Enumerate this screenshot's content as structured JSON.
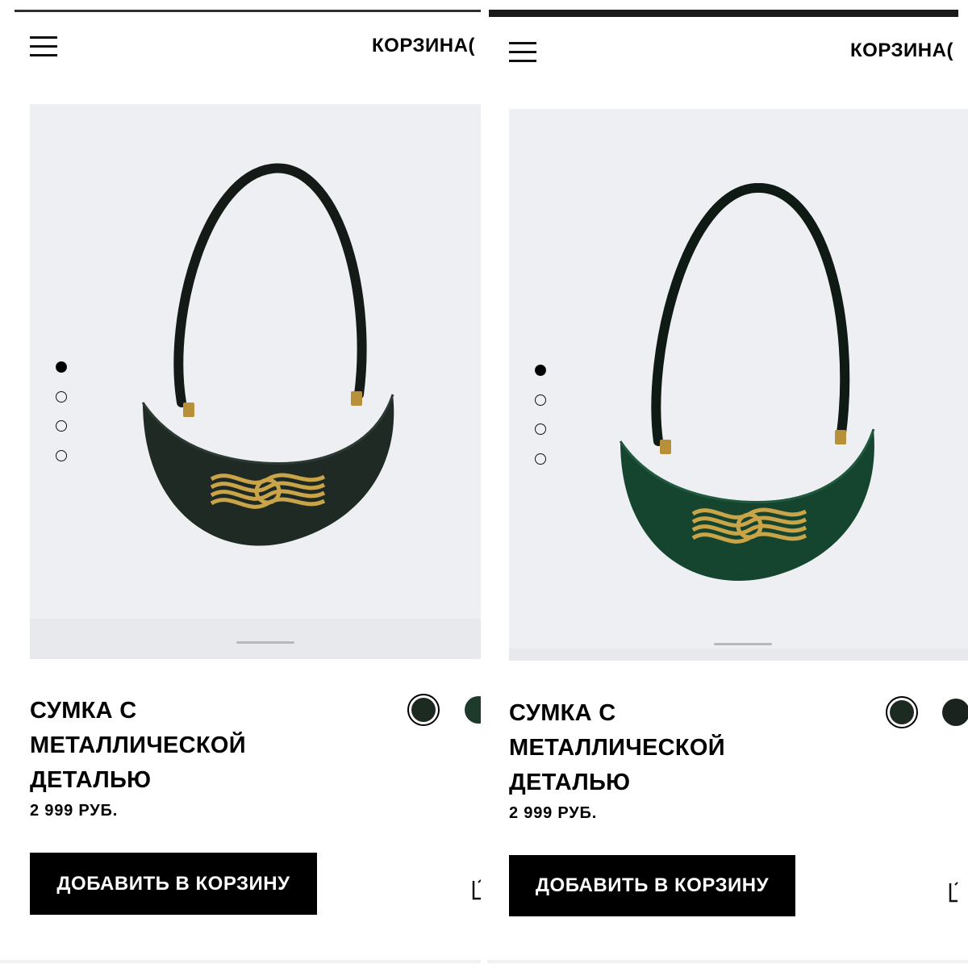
{
  "panels": [
    {
      "header": {
        "cart_label": "КОРЗИНА("
      },
      "gallery": {
        "image_count": 4,
        "active_index": 0
      },
      "product": {
        "title": "СУМКА С МЕТАЛЛИЧЕСКОЙ ДЕТАЛЬЮ",
        "price": "2 999 РУБ.",
        "colors": [
          "#1d2a22",
          "#1d3a2a"
        ],
        "bag_color": "#1f2a24"
      },
      "actions": {
        "add_to_cart": "ДОБАВИТЬ В КОРЗИНУ"
      }
    },
    {
      "header": {
        "cart_label": "КОРЗИНА("
      },
      "gallery": {
        "image_count": 4,
        "active_index": 0
      },
      "product": {
        "title": "СУМКА С МЕТАЛЛИЧЕСКОЙ ДЕТАЛЬЮ",
        "price": "2 999 РУБ.",
        "colors": [
          "#1d2a22",
          "#1b231e"
        ],
        "bag_color": "#15452f"
      },
      "actions": {
        "add_to_cart": "ДОБАВИТЬ В КОРЗИНУ"
      }
    }
  ],
  "icons": {
    "menu": "hamburger-menu-icon",
    "side": "size-guide-icon"
  }
}
